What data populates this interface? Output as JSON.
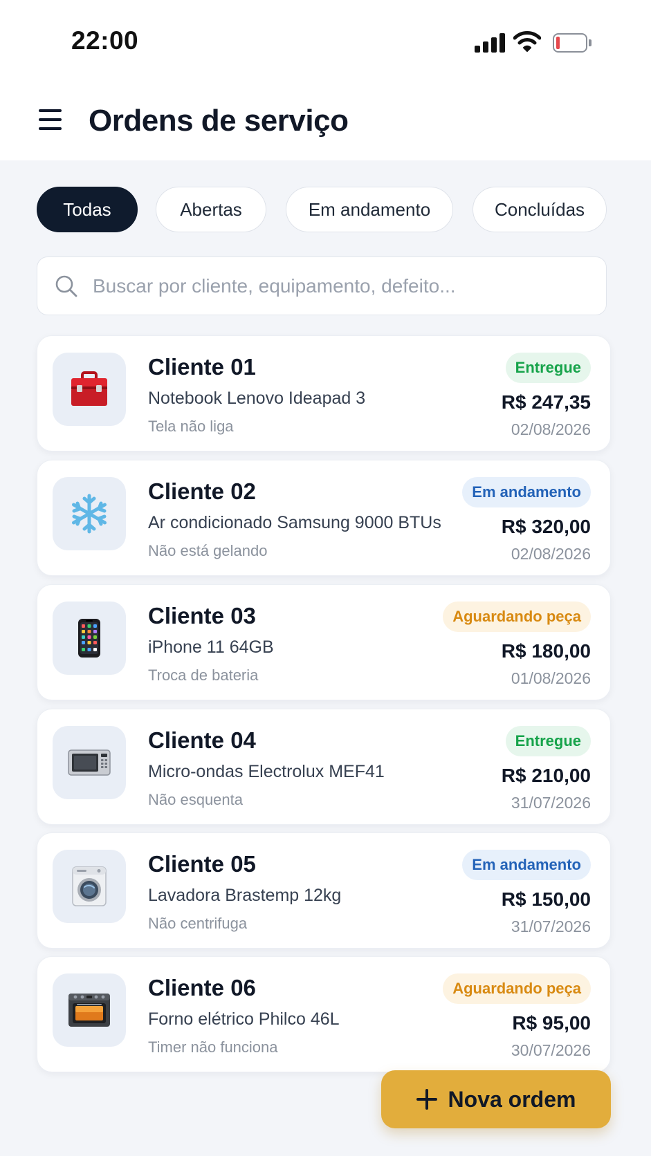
{
  "status_bar": {
    "time": "22:00"
  },
  "header": {
    "title": "Ordens de serviço"
  },
  "filters": [
    {
      "label": "Todas",
      "active": true
    },
    {
      "label": "Abertas",
      "active": false
    },
    {
      "label": "Em andamento",
      "active": false
    },
    {
      "label": "Concluídas",
      "active": false
    }
  ],
  "search": {
    "placeholder": "Buscar por cliente, equipamento, defeito...",
    "value": ""
  },
  "orders": [
    {
      "client": "Cliente 01",
      "device": "Notebook Lenovo Ideapad 3",
      "issue": "Tela não liga",
      "status": "Entregue",
      "status_type": "entregue",
      "price": "R$ 247,35",
      "date": "02/08/2026",
      "icon": "toolbox-icon"
    },
    {
      "client": "Cliente 02",
      "device": "Ar condicionado Samsung 9000 BTUs",
      "issue": "Não está gelando",
      "status": "Em andamento",
      "status_type": "andamento",
      "price": "R$ 320,00",
      "date": "02/08/2026",
      "icon": "snowflake-icon"
    },
    {
      "client": "Cliente 03",
      "device": "iPhone 11 64GB",
      "issue": "Troca de bateria",
      "status": "Aguardando peça",
      "status_type": "aguardando",
      "price": "R$ 180,00",
      "date": "01/08/2026",
      "icon": "smartphone-icon"
    },
    {
      "client": "Cliente 04",
      "device": "Micro-ondas Electrolux MEF41",
      "issue": "Não esquenta",
      "status": "Entregue",
      "status_type": "entregue",
      "price": "R$ 210,00",
      "date": "31/07/2026",
      "icon": "microwave-icon"
    },
    {
      "client": "Cliente 05",
      "device": "Lavadora Brastemp 12kg",
      "issue": "Não centrifuga",
      "status": "Em andamento",
      "status_type": "andamento",
      "price": "R$ 150,00",
      "date": "31/07/2026",
      "icon": "washing-machine-icon"
    },
    {
      "client": "Cliente 06",
      "device": "Forno elétrico Philco 46L",
      "issue": "Timer não funciona",
      "status": "Aguardando peça",
      "status_type": "aguardando",
      "price": "R$ 95,00",
      "date": "30/07/2026",
      "icon": "oven-icon"
    }
  ],
  "fab": {
    "label": "Nova ordem"
  },
  "colors": {
    "background": "#f3f5f9",
    "active_chip": "#0f1b2d",
    "fab": "#e2ad3c",
    "status_entregue": "#16a34a",
    "status_andamento": "#2463b8",
    "status_aguardando": "#d88a12"
  }
}
